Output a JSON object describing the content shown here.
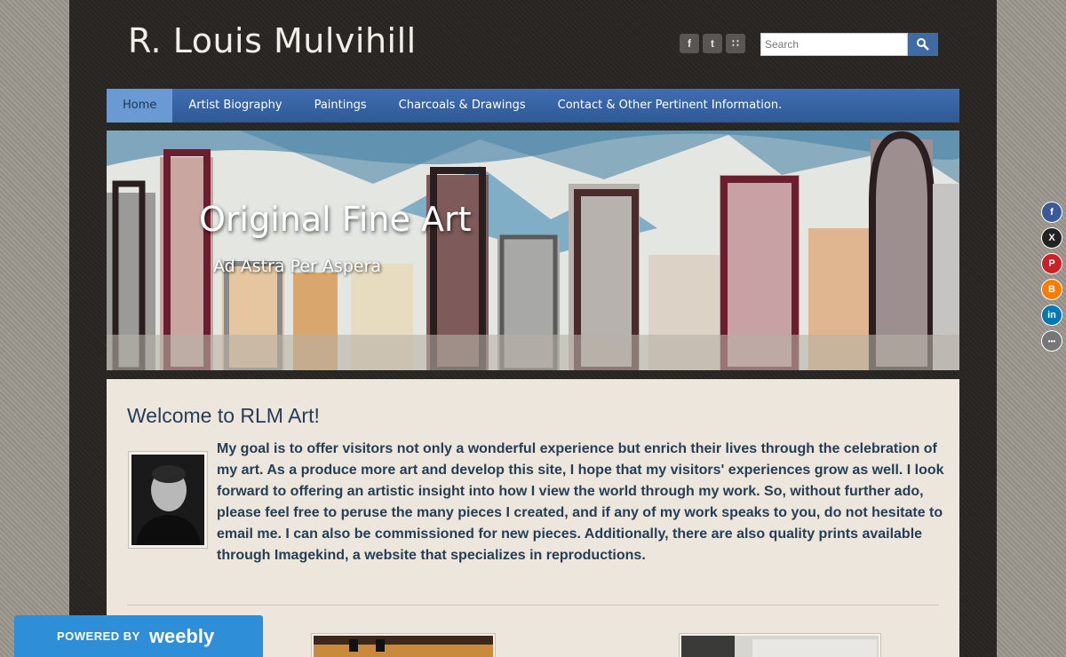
{
  "header": {
    "site_title": "R. Louis Mulvihill",
    "social": [
      {
        "icon": "facebook-icon",
        "glyph": "f"
      },
      {
        "icon": "twitter-icon",
        "glyph": "t"
      },
      {
        "icon": "rss-icon",
        "glyph": "∷"
      }
    ],
    "search": {
      "placeholder": "Search"
    }
  },
  "nav": {
    "items": [
      {
        "label": "Home",
        "active": true
      },
      {
        "label": "Artist Biography"
      },
      {
        "label": "Paintings"
      },
      {
        "label": "Charcoals & Drawings"
      },
      {
        "label": "Contact & Other Pertinent Information."
      }
    ]
  },
  "banner": {
    "title": "Original Fine Art",
    "subtitle": "Ad Astra Per Aspera"
  },
  "main": {
    "heading": "Welcome to RLM Art!",
    "paragraph": "My goal is to offer visitors not only a wonderful experience but enrich their lives through the celebration of my art. As a produce more art and develop this site, I hope that my visitors' experiences grow as well. I look forward to offering an artistic insight into how I view the world through my work. So, without further ado, please feel free to peruse the many pieces I created, and if any of my work speaks to you, do not hesitate to email me. I can also be commissioned for new pieces. Additionally, there are also quality prints available through Imagekind, a website that specializes in reproductions."
  },
  "share_bar": [
    {
      "icon": "facebook-share-icon",
      "glyph": "f",
      "color": "#3b5998"
    },
    {
      "icon": "x-share-icon",
      "glyph": "X",
      "color": "#222222"
    },
    {
      "icon": "pinterest-share-icon",
      "glyph": "P",
      "color": "#cb2027"
    },
    {
      "icon": "blogger-share-icon",
      "glyph": "B",
      "color": "#f57d00"
    },
    {
      "icon": "linkedin-share-icon",
      "glyph": "in",
      "color": "#0077b5"
    },
    {
      "icon": "more-share-icon",
      "glyph": "•••",
      "color": "#777777"
    }
  ],
  "footer_badge": {
    "powered_by": "POWERED BY",
    "brand": "weebly"
  },
  "colors": {
    "nav_blue": "#3f6db0",
    "nav_active": "#6a9ad4",
    "content_bg": "#ece6dc",
    "text_navy": "#263e55",
    "weebly_blue": "#2e8fd8"
  }
}
